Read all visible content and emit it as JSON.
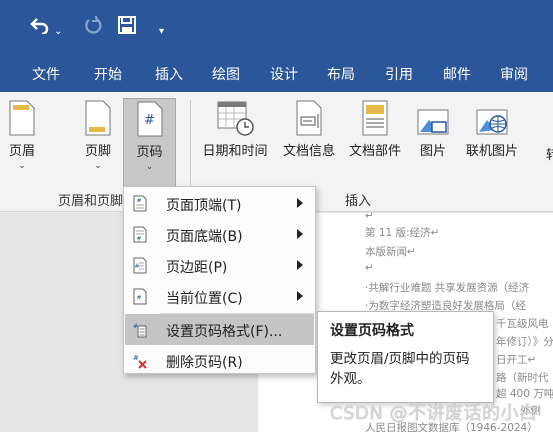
{
  "quick_access": {
    "undo_icon": "undo-icon",
    "redo_icon": "redo-icon",
    "save_icon": "save-icon",
    "customize_icon": "customize-qat-icon"
  },
  "tabs": [
    "文件",
    "开始",
    "插入",
    "绘图",
    "设计",
    "布局",
    "引用",
    "邮件",
    "审阅"
  ],
  "ribbon": {
    "header_footer_group": {
      "label": "页眉和页脚",
      "buttons": [
        {
          "label": "页眉",
          "icon": "header-icon"
        },
        {
          "label": "页脚",
          "icon": "footer-icon"
        },
        {
          "label": "页码",
          "icon": "page-number-icon"
        }
      ]
    },
    "insert_group": {
      "label": "插入",
      "buttons": [
        {
          "label": "日期和时间",
          "icon": "date-time-icon"
        },
        {
          "label": "文档信息",
          "icon": "document-info-icon"
        },
        {
          "label": "文档部件",
          "icon": "document-parts-icon"
        },
        {
          "label": "图片",
          "icon": "picture-icon"
        },
        {
          "label": "联机图片",
          "icon": "online-picture-icon"
        }
      ]
    },
    "truncated_label": "转"
  },
  "dropdown": {
    "items": [
      {
        "label": "页面顶端(T)",
        "submenu": true,
        "icon": "page-top-icon"
      },
      {
        "label": "页面底端(B)",
        "submenu": true,
        "icon": "page-bottom-icon"
      },
      {
        "label": "页边距(P)",
        "submenu": true,
        "icon": "page-margin-icon"
      },
      {
        "label": "当前位置(C)",
        "submenu": true,
        "icon": "current-position-icon"
      },
      {
        "label": "设置页码格式(F)...",
        "submenu": false,
        "icon": "format-page-number-icon"
      },
      {
        "label": "删除页码(R)",
        "submenu": false,
        "icon": "remove-page-number-icon"
      }
    ]
  },
  "tooltip": {
    "title": "设置页码格式",
    "description": "更改页眉/页脚中的页码外观。"
  },
  "document": {
    "lines": [
      "↵",
      "第 11 版:经济↵",
      "本版新闻↵",
      "↵",
      "·共解行业难题 共享发展资源（经济",
      "·为数字经济塑造良好发展格局（经",
      "千瓦级风电",
      "年修订）》分",
      "日开工↵",
      "路（新时代",
      "超 400 万吨",
      "外侧",
      "人民日报图文数据库（1946-2024）"
    ]
  },
  "watermark": "CSDN @不讲废话的小白"
}
